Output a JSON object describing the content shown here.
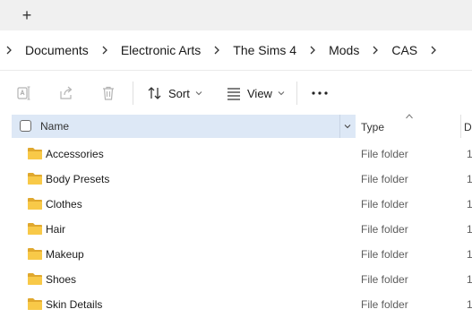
{
  "tabstrip": {
    "new_tab_label": "+"
  },
  "breadcrumb": {
    "items": [
      "Documents",
      "Electronic Arts",
      "The Sims 4",
      "Mods",
      "CAS"
    ]
  },
  "toolbar": {
    "sort_label": "Sort",
    "view_label": "View",
    "more_label": "•••"
  },
  "columns": {
    "name": "Name",
    "type": "Type",
    "date": "D"
  },
  "files": [
    {
      "name": "Accessories",
      "type": "File folder",
      "date": "1"
    },
    {
      "name": "Body Presets",
      "type": "File folder",
      "date": "1"
    },
    {
      "name": "Clothes",
      "type": "File folder",
      "date": "1"
    },
    {
      "name": "Hair",
      "type": "File folder",
      "date": "1"
    },
    {
      "name": "Makeup",
      "type": "File folder",
      "date": "1"
    },
    {
      "name": "Shoes",
      "type": "File folder",
      "date": "1"
    },
    {
      "name": "Skin Details",
      "type": "File folder",
      "date": "1"
    }
  ],
  "colors": {
    "selected_header": "#dde8f6",
    "folder_yellow": "#f8c948",
    "folder_dark": "#e0a82e"
  }
}
